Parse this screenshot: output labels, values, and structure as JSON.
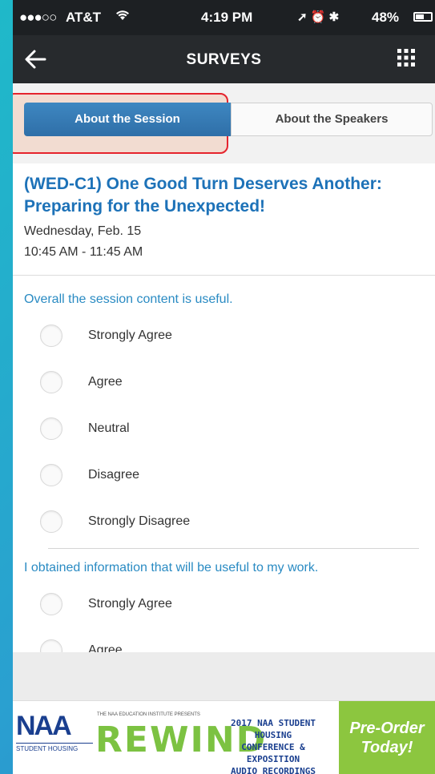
{
  "status_bar": {
    "signal": "●●●○○",
    "carrier": "AT&T",
    "wifi_icon": "wifi-icon",
    "time": "4:19 PM",
    "icons": "➚ ⏰ ✱",
    "battery": "48%"
  },
  "nav": {
    "title": "SURVEYS",
    "back_icon": "back-arrow-icon",
    "menu_icon": "grid-menu-icon"
  },
  "tabs": [
    {
      "label": "About the Session",
      "active": true
    },
    {
      "label": "About the Speakers",
      "active": false
    }
  ],
  "session": {
    "title": "(WED-C1) One Good Turn Deserves Another: Preparing for the Unexpected!",
    "date": "Wednesday, Feb. 15",
    "time": "10:45 AM - 11:45 AM"
  },
  "questions": [
    {
      "text": "Overall the session content is useful.",
      "options": [
        "Strongly Agree",
        "Agree",
        "Neutral",
        "Disagree",
        "Strongly Disagree"
      ]
    },
    {
      "text": "I obtained information that will be useful to my work.",
      "options": [
        "Strongly Agree",
        "Agree"
      ]
    }
  ],
  "ad": {
    "naa_logo": "NAA",
    "naa_student": "STUDENT HOUSING",
    "presents": "THE NAA EDUCATION INSTITUTE PRESENTS",
    "rewind": "REWIND",
    "line1": "2017 NAA STUDENT HOUSING",
    "line2": "CONFERENCE & EXPOSITION",
    "line3": "AUDIO RECORDINGS",
    "cta1": "Pre-Order",
    "cta2": "Today!"
  },
  "colors": {
    "accent": "#2a8bc3",
    "tab_active": "#3a80bc",
    "highlight": "#e5242d",
    "ad_green": "#8cc63f"
  }
}
